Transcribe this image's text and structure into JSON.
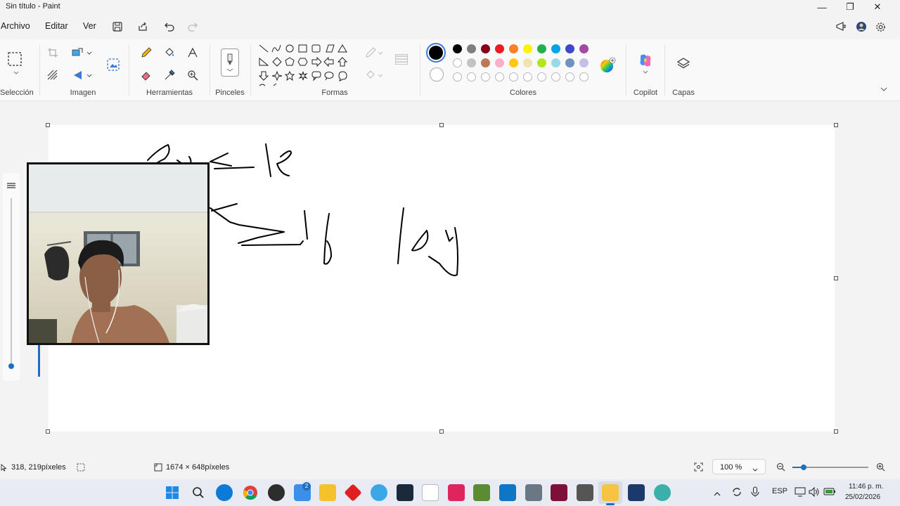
{
  "window": {
    "title": "Sin título - Paint"
  },
  "menu": {
    "archivo": "Archivo",
    "editar": "Editar",
    "ver": "Ver"
  },
  "ribbon": {
    "groups": {
      "seleccion": "Selección",
      "imagen": "Imagen",
      "herramientas": "Herramientas",
      "pinceles": "Pinceles",
      "formas": "Formas",
      "colores": "Colores",
      "copilot": "Copilot",
      "capas": "Capas"
    },
    "palette_row1": [
      "#000000",
      "#7f7f7f",
      "#880015",
      "#ed1c24",
      "#ff7f27",
      "#fff200",
      "#22b14c",
      "#00a2e8",
      "#3f48cc",
      "#a349a4"
    ],
    "palette_row2": [
      "#ffffff",
      "#c3c3c3",
      "#b97a57",
      "#ffaec9",
      "#ffc90e",
      "#efe4b0",
      "#b5e61d",
      "#99d9ea",
      "#7092be",
      "#c8bfe7"
    ],
    "primary_color": "#000000",
    "secondary_color": "#ffffff"
  },
  "status": {
    "cursor_pos": "318, 219píxeles",
    "canvas_size": "1674 × 648píxeles",
    "zoom": "100 %"
  },
  "taskbar": {
    "badge_count": "2",
    "language": "ESP",
    "time": "11:46 p. m.",
    "date": "25/02/2026"
  }
}
